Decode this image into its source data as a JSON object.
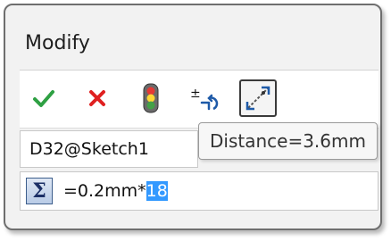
{
  "dialog": {
    "title": "Modify"
  },
  "toolbar": {
    "buttons": [
      {
        "name": "ok",
        "icon": "checkmark-icon",
        "color": "#2ea043"
      },
      {
        "name": "cancel",
        "icon": "close-icon",
        "color": "#e02020"
      },
      {
        "name": "rebuild",
        "icon": "traffic-light-icon"
      },
      {
        "name": "reverse",
        "icon": "reverse-direction-icon"
      },
      {
        "name": "mark-dimension",
        "icon": "mark-dimension-icon",
        "state": "pressed"
      }
    ]
  },
  "dimension": {
    "name": "D32@Sketch1"
  },
  "tooltip": {
    "text": "Distance=3.6mm"
  },
  "expression": {
    "prefix": "=0.2mm*",
    "selected": "18",
    "sigma_symbol": "Σ"
  }
}
